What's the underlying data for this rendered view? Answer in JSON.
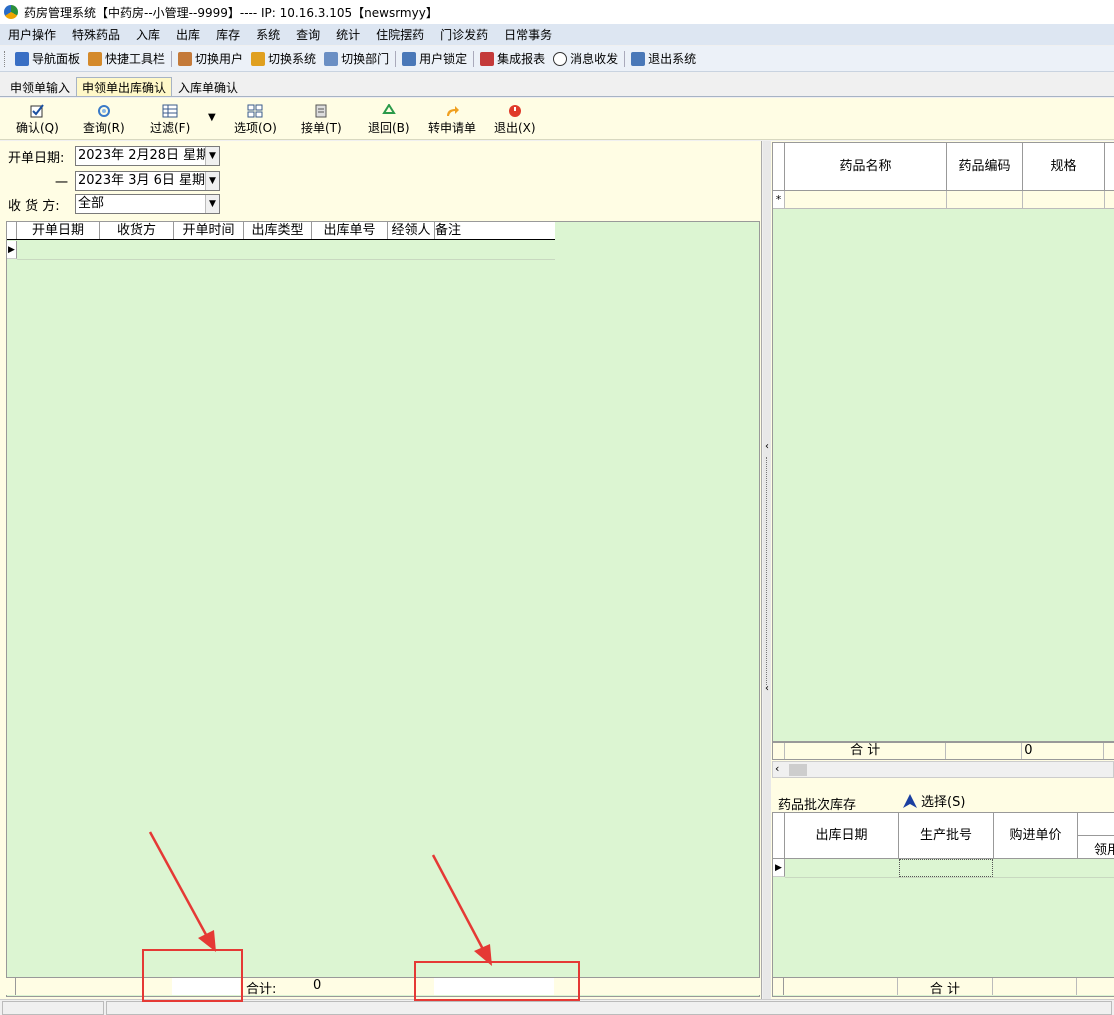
{
  "window": {
    "title": "药房管理系统【中药房--小管理--9999】---- IP:  10.16.3.105【newsrmyy】"
  },
  "menu": [
    "用户操作",
    "特殊药品",
    "入库",
    "出库",
    "库存",
    "系统",
    "查询",
    "统计",
    "住院摆药",
    "门诊发药",
    "日常事务"
  ],
  "toolbar": {
    "nav_panel": "导航面板",
    "quick_toolbar": "快捷工具栏",
    "switch_user": "切换用户",
    "switch_system": "切换系统",
    "switch_dept": "切换部门",
    "user_lock": "用户锁定",
    "integrated_report": "集成报表",
    "messages": "消息收发",
    "exit_system": "退出系统"
  },
  "tabs": [
    "申领单输入",
    "申领单出库确认",
    "入库单确认"
  ],
  "actions": {
    "confirm": "确认(Q)",
    "query": "查询(R)",
    "filter": "过滤(F)",
    "options": "选项(O)",
    "receive": "接单(T)",
    "return": "退回(B)",
    "transfer": "转申请单",
    "exit": "退出(X)"
  },
  "filters": {
    "date_label": "开单日期:",
    "date_from": "2023年  2月28日  星期",
    "dash": "一",
    "date_to": "2023年  3月  6日  星期",
    "receiver_label": "收 货 方:",
    "receiver_value": "全部"
  },
  "left_grid": {
    "columns": [
      "开单日期",
      "收货方",
      "开单时间",
      "出库类型",
      "出库单号",
      "经领人",
      "备注"
    ],
    "footer_total_label": "合计:",
    "footer_total_value": "0"
  },
  "right_grid": {
    "columns": [
      "药品名称",
      "药品编码",
      "规格",
      ""
    ],
    "new_row_marker": "*",
    "total_label": "合  计",
    "total_value": "0"
  },
  "batch": {
    "title": "药品批次库存",
    "select_button": "选择(S)",
    "columns": [
      "出库日期",
      "生产批号",
      "购进单价",
      "领用"
    ],
    "total_label": "合  计"
  },
  "colors": {
    "grid_bg": "#dcf5d2",
    "panel_bg": "#fffde4",
    "annotation": "#e53935"
  }
}
